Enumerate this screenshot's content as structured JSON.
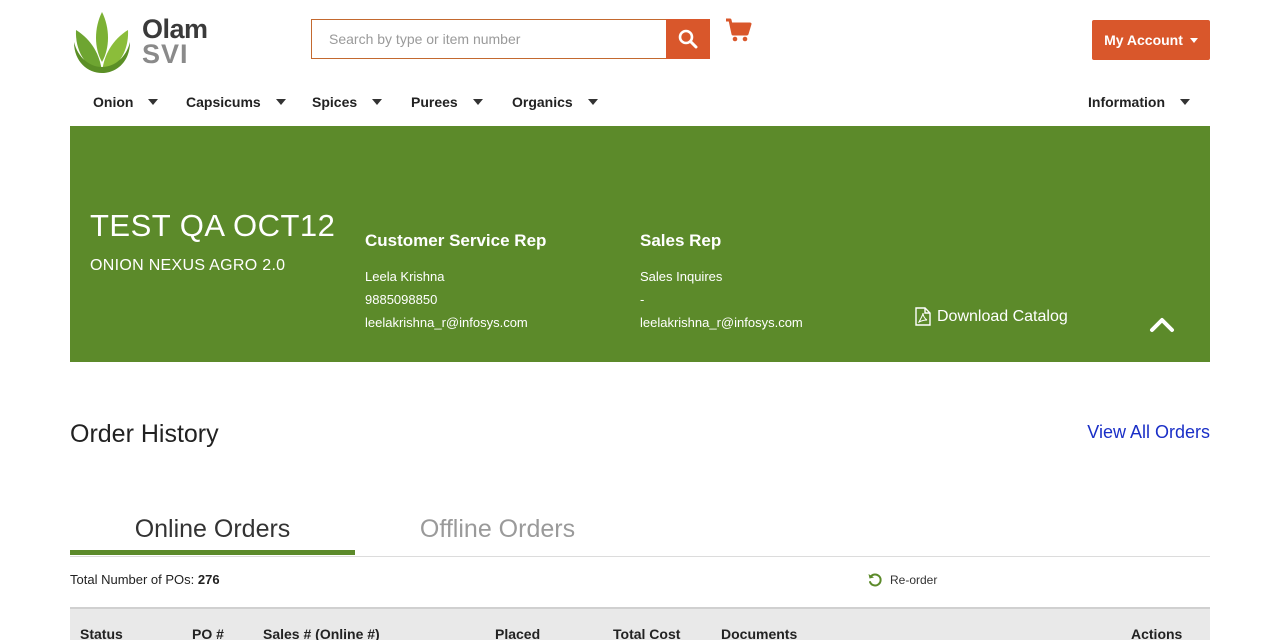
{
  "brand": {
    "line1": "Olam",
    "line2": "SVI"
  },
  "search": {
    "placeholder": "Search by type or item number"
  },
  "icons": {
    "search": "search-icon",
    "cart": "shopping-cart-icon",
    "pdf": "pdf-file-icon",
    "scroll_top": "chevron-up-icon",
    "reorder": "refresh-icon"
  },
  "colors": {
    "accent": "#d9572b",
    "banner": "#5c8a2a",
    "link": "#1a2fc7"
  },
  "account": {
    "label": "My Account"
  },
  "nav": {
    "items": [
      "Onion",
      "Capsicums",
      "Spices",
      "Purees",
      "Organics"
    ],
    "right": "Information"
  },
  "banner": {
    "account_name": "TEST QA OCT12",
    "account_sub": "ONION NEXUS AGRO 2.0",
    "csr": {
      "title": "Customer Service Rep",
      "name": "Leela Krishna",
      "phone": "9885098850",
      "email": "leelakrishna_r@infosys.com"
    },
    "sales": {
      "title": "Sales Rep",
      "name": "Sales Inquires",
      "phone": "-",
      "email": "leelakrishna_r@infosys.com"
    },
    "download": "Download Catalog"
  },
  "orders": {
    "title": "Order History",
    "view_all": "View All Orders",
    "tabs": {
      "online": "Online Orders",
      "offline": "Offline Orders"
    },
    "total_label": "Total Number of POs:",
    "total_value": "276",
    "reorder": "Re-order",
    "columns": [
      "Status",
      "PO #",
      "Sales # (Online #)",
      "Placed",
      "Total Cost",
      "Documents",
      "Actions"
    ]
  }
}
